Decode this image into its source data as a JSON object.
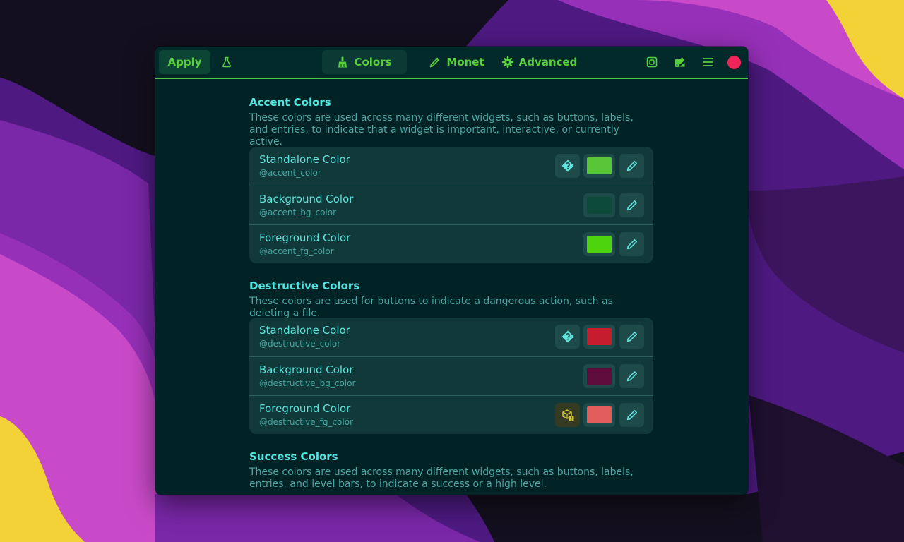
{
  "colors": {
    "wallpaper_dark": "#140f1e",
    "wallpaper_purple": "#4e1a82",
    "wallpaper_violet": "#9630b8",
    "wallpaper_magenta": "#c94ac8",
    "wallpaper_yellow": "#f3d237",
    "window_bg": "#022326",
    "headerbar_accent": "#58cf3c",
    "close_button": "#f0245a"
  },
  "header": {
    "apply_label": "Apply",
    "flask_icon": "flask-icon",
    "tabs": [
      {
        "label": "Colors",
        "icon": "broom-icon",
        "active": true
      },
      {
        "label": "Monet",
        "icon": "eyedropper-icon",
        "active": false
      },
      {
        "label": "Advanced",
        "icon": "gear-icon",
        "active": false
      }
    ],
    "right_icons": [
      "screenshot-icon",
      "palette-icon",
      "menu-icon",
      "close-icon"
    ]
  },
  "sections": [
    {
      "title": "Accent Colors",
      "description": "These colors are used across many different widgets, such as buttons, labels, and entries, to indicate that a widget is important, interactive, or currently active.",
      "rows": [
        {
          "title": "Standalone Color",
          "variable": "@accent_color",
          "swatch": "#58c637",
          "badge": "help"
        },
        {
          "title": "Background Color",
          "variable": "@accent_bg_color",
          "swatch": "#0e4a39",
          "badge": "none"
        },
        {
          "title": "Foreground Color",
          "variable": "@accent_fg_color",
          "swatch": "#4ed30f",
          "badge": "none"
        }
      ]
    },
    {
      "title": "Destructive Colors",
      "description": "These colors are used for buttons to indicate a dangerous action, such as deleting a file.",
      "rows": [
        {
          "title": "Standalone Color",
          "variable": "@destructive_color",
          "swatch": "#c51d2e",
          "badge": "help"
        },
        {
          "title": "Background Color",
          "variable": "@destructive_bg_color",
          "swatch": "#5d0c3b",
          "badge": "none"
        },
        {
          "title": "Foreground Color",
          "variable": "@destructive_fg_color",
          "swatch": "#e05d5c",
          "badge": "warning"
        }
      ]
    },
    {
      "title": "Success Colors",
      "description": "These colors are used across many different widgets, such as buttons, labels, entries, and level bars, to indicate a success or a high level.",
      "rows": []
    }
  ]
}
